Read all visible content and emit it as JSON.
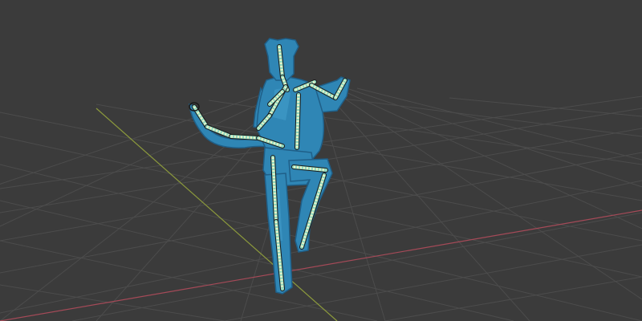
{
  "viewport": {
    "background_color": "#3b3b3b",
    "grid_color": "#4c4c4c",
    "x_axis_color": "#a54a58",
    "y_axis_color": "#8c9a3c"
  },
  "model": {
    "mesh_color": "#2f86b5",
    "mesh_dark_color": "#1f5f88",
    "mesh_light_color": "#4aa6d3",
    "bone_color": "#8fd8c0",
    "bone_stripe_color": "#e9f3c7",
    "bone_outline_color": "#1a1a1a"
  },
  "icons": [
    "grid-floor-icon",
    "armature-icon",
    "character-mesh-icon"
  ]
}
